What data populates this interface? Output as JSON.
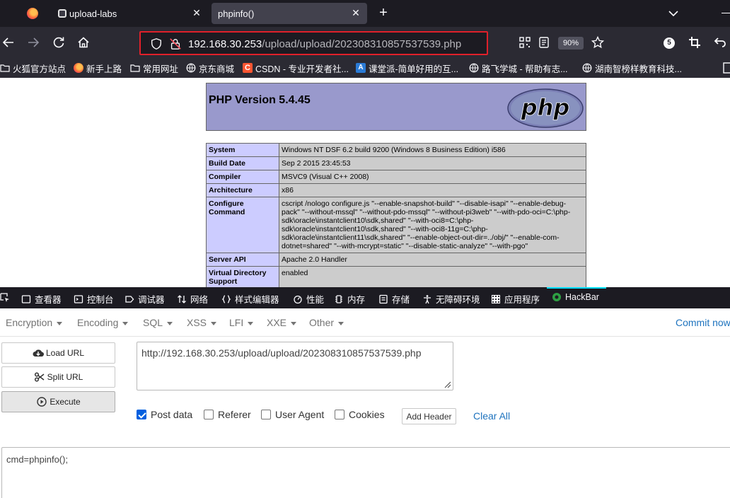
{
  "browser": {
    "tabs": [
      {
        "label": "upload-labs",
        "active": false
      },
      {
        "label": "phpinfo()",
        "active": true
      }
    ],
    "url": {
      "host": "192.168.30.253",
      "path": "/upload/upload/202308310857537539.php"
    },
    "zoom": "90%",
    "notification_count": "5",
    "bookmarks": [
      {
        "label": "火狐官方站点",
        "icon": "folder-icon"
      },
      {
        "label": "新手上路",
        "icon": "firefox-icon"
      },
      {
        "label": "常用网址",
        "icon": "folder-icon"
      },
      {
        "label": "京东商城",
        "icon": "globe-icon"
      },
      {
        "label": "CSDN - 专业开发者社...",
        "icon": "csdn-icon"
      },
      {
        "label": "课堂派-简单好用的互...",
        "icon": "ketangpai-icon"
      },
      {
        "label": "路飞学城 - 帮助有志...",
        "icon": "globe-icon"
      },
      {
        "label": "湖南智榜样教育科技...",
        "icon": "globe-icon"
      }
    ]
  },
  "phpinfo": {
    "title": "PHP Version 5.4.45",
    "logo_text": "php",
    "rows": [
      {
        "key": "System",
        "value": "Windows NT DSF 6.2 build 9200 (Windows 8 Business Edition) i586"
      },
      {
        "key": "Build Date",
        "value": "Sep 2 2015 23:45:53"
      },
      {
        "key": "Compiler",
        "value": "MSVC9 (Visual C++ 2008)"
      },
      {
        "key": "Architecture",
        "value": "x86"
      },
      {
        "key": "Configure Command",
        "value": "cscript /nologo configure.js \"--enable-snapshot-build\" \"--disable-isapi\" \"--enable-debug-pack\" \"--without-mssql\" \"--without-pdo-mssql\" \"--without-pi3web\" \"--with-pdo-oci=C:\\php-sdk\\oracle\\instantclient10\\sdk,shared\" \"--with-oci8=C:\\php-sdk\\oracle\\instantclient10\\sdk,shared\" \"--with-oci8-11g=C:\\php-sdk\\oracle\\instantclient11\\sdk,shared\" \"--enable-object-out-dir=../obj/\" \"--enable-com-dotnet=shared\" \"--with-mcrypt=static\" \"--disable-static-analyze\" \"--with-pgo\""
      },
      {
        "key": "Server API",
        "value": "Apache 2.0 Handler"
      },
      {
        "key": "Virtual Directory Support",
        "value": "enabled"
      }
    ]
  },
  "devtools": {
    "tabs": [
      {
        "label": "查看器",
        "icon": "inspector-icon"
      },
      {
        "label": "控制台",
        "icon": "console-icon"
      },
      {
        "label": "调试器",
        "icon": "debugger-icon"
      },
      {
        "label": "网络",
        "icon": "network-icon"
      },
      {
        "label": "样式编辑器",
        "icon": "style-editor-icon"
      },
      {
        "label": "性能",
        "icon": "performance-icon"
      },
      {
        "label": "内存",
        "icon": "memory-icon"
      },
      {
        "label": "存储",
        "icon": "storage-icon"
      },
      {
        "label": "无障碍环境",
        "icon": "accessibility-icon"
      },
      {
        "label": "应用程序",
        "icon": "application-icon"
      },
      {
        "label": "HackBar",
        "icon": "hackbar-icon"
      }
    ],
    "active_tab": "HackBar"
  },
  "hackbar": {
    "menus": [
      "Encryption",
      "Encoding",
      "SQL",
      "XSS",
      "LFI",
      "XXE",
      "Other"
    ],
    "commit_label": "Commit now",
    "buttons": {
      "load_url": "Load URL",
      "split_url": "Split URL",
      "execute": "Execute"
    },
    "url_value": "http://192.168.30.253/upload/upload/202308310857537539.php",
    "options": [
      {
        "label": "Post data",
        "checked": true
      },
      {
        "label": "Referer",
        "checked": false
      },
      {
        "label": "User Agent",
        "checked": false
      },
      {
        "label": "Cookies",
        "checked": false
      }
    ],
    "add_header_label": "Add Header",
    "clear_all_label": "Clear All",
    "post_data_value": "cmd=phpinfo();"
  }
}
